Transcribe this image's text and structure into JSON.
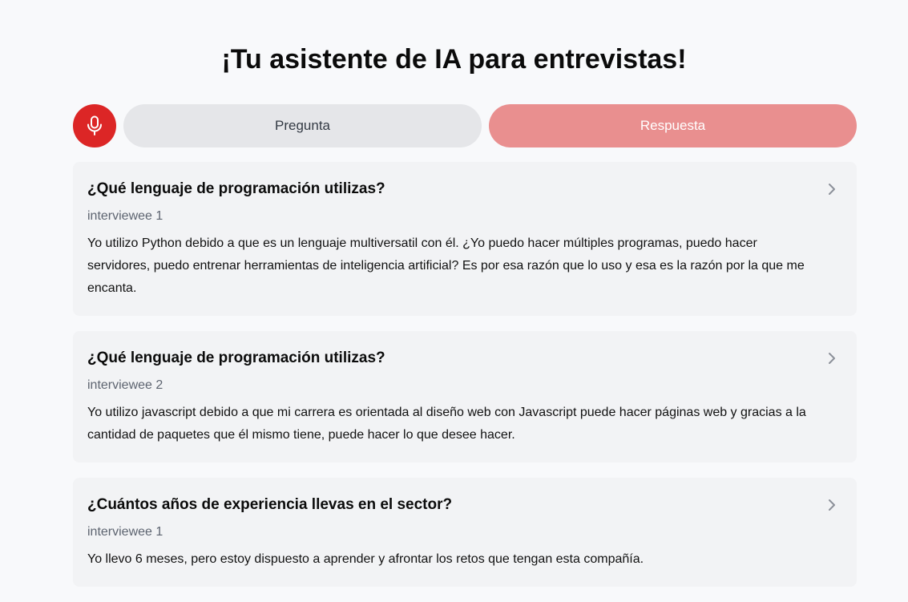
{
  "header": {
    "title": "¡Tu asistente de IA para entrevistas!"
  },
  "controls": {
    "mic_icon": "microphone-icon",
    "mic_color": "#dc2626",
    "question_tab_label": "Pregunta",
    "answer_tab_label": "Respuesta",
    "answer_tab_color": "#e98f8f"
  },
  "cards": [
    {
      "question": "¿Qué lenguaje de programación utilizas?",
      "speaker": "interviewee 1",
      "answer": "Yo utilizo Python debido a que es un lenguaje multiversatil con él. ¿Yo puedo hacer múltiples programas, puedo hacer servidores, puedo entrenar herramientas de inteligencia artificial? Es por esa razón que lo uso y esa es la razón por la que me encanta.",
      "icon": "chevron-right-icon"
    },
    {
      "question": "¿Qué lenguaje de programación utilizas?",
      "speaker": "interviewee 2",
      "answer": "Yo utilizo javascript debido a que mi carrera es orientada al diseño web con Javascript puede hacer páginas web y gracias a la cantidad de paquetes que él mismo tiene, puede hacer lo que desee hacer.",
      "icon": "chevron-right-icon"
    },
    {
      "question": "¿Cuántos años de experiencia llevas en el sector?",
      "speaker": "interviewee 1",
      "answer": "Yo llevo 6 meses, pero estoy dispuesto a aprender y afrontar los retos que tengan esta compañía.",
      "icon": "chevron-right-icon"
    }
  ]
}
